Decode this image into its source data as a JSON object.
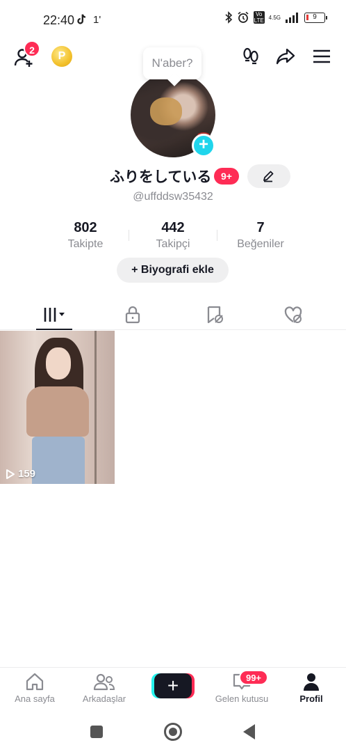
{
  "status_bar": {
    "time": "22:40",
    "extra": "1'",
    "network_label": "4.5G",
    "volte_label": "Vo LTE",
    "battery": "9"
  },
  "header": {
    "friend_request_count": "2",
    "coin_label": "P"
  },
  "profile": {
    "tooltip": "N'aber?",
    "display_name": "ふりをしている",
    "name_badge": "9+",
    "handle": "@uffddsw35432",
    "stats": [
      {
        "value": "802",
        "label": "Takipte"
      },
      {
        "value": "442",
        "label": "Takipçi"
      },
      {
        "value": "7",
        "label": "Beğeniler"
      }
    ],
    "bio_button": "+ Biyografi ekle"
  },
  "videos": [
    {
      "views": "159"
    }
  ],
  "bottom_nav": {
    "items": [
      {
        "label": "Ana sayfa",
        "active": false
      },
      {
        "label": "Arkadaşlar",
        "active": false
      },
      {
        "label": "Gelen kutusu",
        "active": false
      },
      {
        "label": "Profil",
        "active": true
      }
    ],
    "create_label": "+",
    "inbox_badge": "99+"
  },
  "colors": {
    "accent": "#fe2c55",
    "cyan": "#20d5ec",
    "text": "#161823",
    "muted": "#8a8b91"
  }
}
